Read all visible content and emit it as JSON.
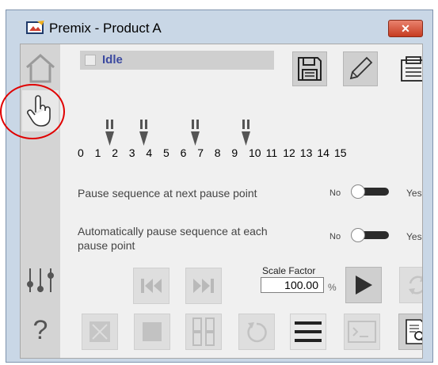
{
  "window": {
    "title": "Premix - Product A",
    "close_glyph": "✕"
  },
  "status": {
    "text": "Idle"
  },
  "sidebar": {
    "home_icon": "home-icon",
    "manual_icon": "hand-pointer-icon",
    "settings_icon": "sliders-icon",
    "help_glyph": "?"
  },
  "toolbar": {
    "save_icon": "save-icon",
    "edit_icon": "pencil-icon",
    "clipboard_icon": "clipboard-icon"
  },
  "sequence": {
    "numbers": [
      "0",
      "1",
      "2",
      "3",
      "4",
      "5",
      "6",
      "7",
      "8",
      "9",
      "10",
      "11",
      "12",
      "13",
      "14",
      "15"
    ],
    "pause_markers_after": [
      1,
      3,
      6,
      9
    ]
  },
  "options": [
    {
      "label_line1": "Pause sequence at next pause point",
      "label_line2": "",
      "no": "No",
      "yes": "Yes"
    },
    {
      "label_line1": "Automatically pause sequence at each",
      "label_line2": "pause point",
      "no": "No",
      "yes": "Yes"
    }
  ],
  "scale_factor": {
    "label": "Scale Factor",
    "value": "100.00",
    "unit": "%"
  },
  "colors": {
    "accent_status": "#3c4aa0",
    "annotation": "#e00000",
    "close_button": "#c63b20"
  }
}
